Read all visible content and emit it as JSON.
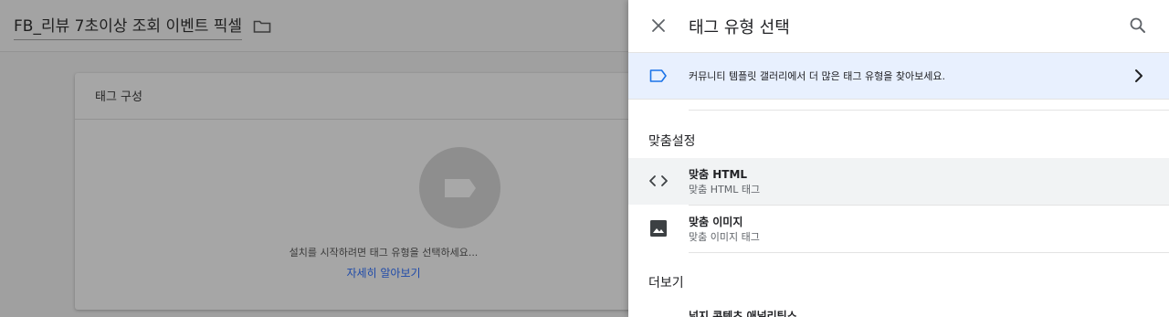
{
  "workspace": {
    "title": "FB_리뷰 7초이상 조회 이벤트 픽셀",
    "card": {
      "title": "태그 구성",
      "hint": "설치를 시작하려면 태그 유형을 선택하세요...",
      "link": "자세히 알아보기"
    }
  },
  "panel": {
    "title": "태그 유형 선택",
    "community": {
      "text": "커뮤니티 템플릿 갤러리에서 더 많은 태그 유형을 찾아보세요."
    },
    "sections": {
      "custom": {
        "label": "맞춤설정",
        "items": [
          {
            "title": "맞춤 HTML",
            "subtitle": "맞춤 HTML 태그",
            "icon": "code-icon"
          },
          {
            "title": "맞춤 이미지",
            "subtitle": "맞춤 이미지 태그",
            "icon": "image-icon"
          }
        ]
      },
      "more": {
        "label": "더보기",
        "first_item": "넓지 콘텐츠 애널리틱스"
      }
    }
  },
  "colors": {
    "accent": "#1a73e8",
    "highlight_row": "#e8f0fe",
    "hover_row": "#f1f3f4",
    "overlay": "#a0a0a0"
  }
}
